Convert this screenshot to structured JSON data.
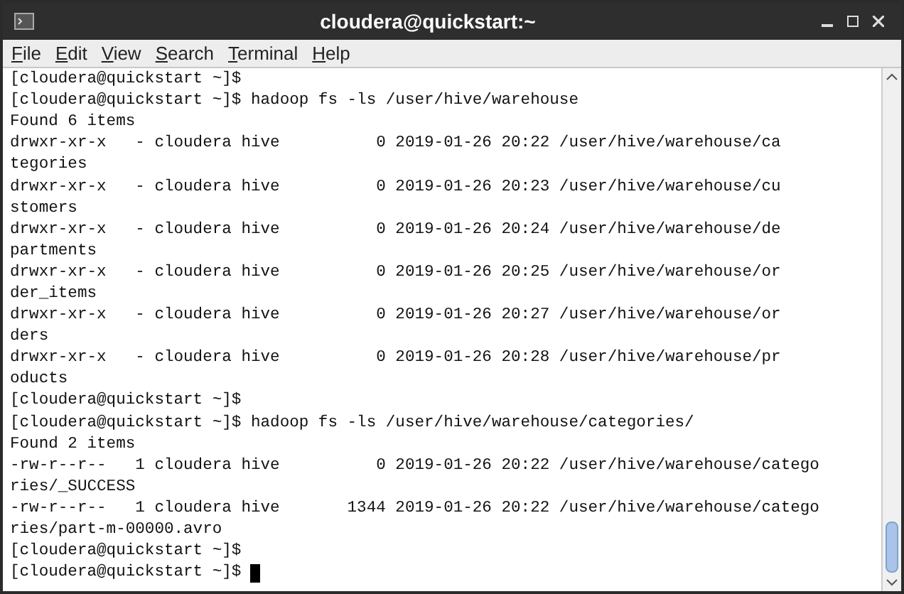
{
  "window": {
    "title": "cloudera@quickstart:~"
  },
  "menu": [
    "File",
    "Edit",
    "View",
    "Search",
    "Terminal",
    "Help"
  ],
  "terminal": {
    "cursor_visible": true,
    "lines": [
      "[cloudera@quickstart ~]$",
      "[cloudera@quickstart ~]$ hadoop fs -ls /user/hive/warehouse",
      "Found 6 items",
      "drwxr-xr-x   - cloudera hive          0 2019-01-26 20:22 /user/hive/warehouse/ca",
      "tegories",
      "drwxr-xr-x   - cloudera hive          0 2019-01-26 20:23 /user/hive/warehouse/cu",
      "stomers",
      "drwxr-xr-x   - cloudera hive          0 2019-01-26 20:24 /user/hive/warehouse/de",
      "partments",
      "drwxr-xr-x   - cloudera hive          0 2019-01-26 20:25 /user/hive/warehouse/or",
      "der_items",
      "drwxr-xr-x   - cloudera hive          0 2019-01-26 20:27 /user/hive/warehouse/or",
      "ders",
      "drwxr-xr-x   - cloudera hive          0 2019-01-26 20:28 /user/hive/warehouse/pr",
      "oducts",
      "[cloudera@quickstart ~]$",
      "[cloudera@quickstart ~]$ hadoop fs -ls /user/hive/warehouse/categories/",
      "Found 2 items",
      "-rw-r--r--   1 cloudera hive          0 2019-01-26 20:22 /user/hive/warehouse/catego",
      "ries/_SUCCESS",
      "-rw-r--r--   1 cloudera hive       1344 2019-01-26 20:22 /user/hive/warehouse/catego",
      "ries/part-m-00000.avro",
      "[cloudera@quickstart ~]$",
      "[cloudera@quickstart ~]$ "
    ]
  }
}
